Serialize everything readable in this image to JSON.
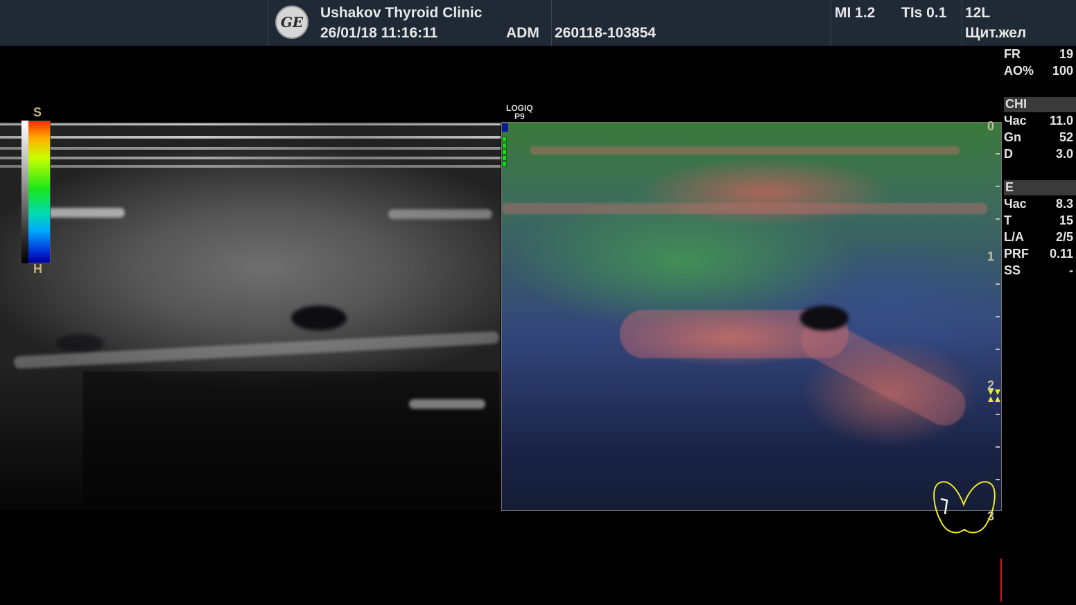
{
  "header": {
    "clinic": "Ushakov Thyroid Clinic",
    "datetime": "26/01/18 11:16:11",
    "operator": "ADM",
    "exam_id": "260118-103854",
    "mi": "MI 1.2",
    "tis": "TIs 0.1",
    "probe": "12L",
    "preset": "Щит.жел",
    "logo_text": "GE"
  },
  "params_top": [
    {
      "k": "FR",
      "v": "19"
    },
    {
      "k": "AO%",
      "v": "100"
    }
  ],
  "chi": {
    "title": "CHI",
    "rows": [
      {
        "k": "Час",
        "v": "11.0"
      },
      {
        "k": "Gn",
        "v": "52"
      },
      {
        "k": "D",
        "v": "3.0"
      }
    ]
  },
  "e": {
    "title": "E",
    "rows": [
      {
        "k": "Час",
        "v": "8.3"
      },
      {
        "k": "T",
        "v": "15"
      },
      {
        "k": "L/A",
        "v": "2/5"
      },
      {
        "k": "PRF",
        "v": "0.11"
      },
      {
        "k": "SS",
        "v": "-"
      }
    ]
  },
  "scale": {
    "top": "S",
    "bottom": "H"
  },
  "logiq": {
    "line1": "LOGIQ",
    "line2": "P9"
  },
  "depth_labels": [
    "0",
    "1",
    "2",
    "3"
  ],
  "colors": {
    "header_bg": "#1f2a36",
    "text": "#e8e8e8",
    "depth": "#bfbfa6",
    "thyroid_outline": "#f2ea2a"
  }
}
